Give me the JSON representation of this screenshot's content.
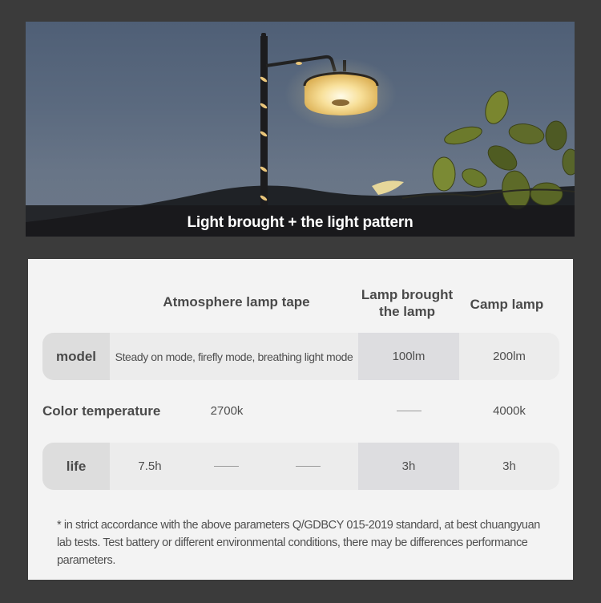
{
  "hero": {
    "caption": "Light brought + the light pattern",
    "image_description": "Dusk sky with a lamp post wrapped in an LED light strip, a glowing round camp lamp hanging from its arm, and green leaves in the foreground"
  },
  "spec_table": {
    "columns": [
      {
        "key": "label",
        "header": ""
      },
      {
        "key": "atmosphere",
        "header": "Atmosphere lamp tape"
      },
      {
        "key": "lamp_brought",
        "header": "Lamp brought the lamp"
      },
      {
        "key": "camp",
        "header": "Camp lamp"
      }
    ],
    "header_lines": {
      "atmosphere": "Atmosphere lamp tape",
      "lamp_brought_line1": "Lamp brought",
      "lamp_brought_line2": "the lamp",
      "camp": "Camp lamp"
    },
    "rows": [
      {
        "label": "model",
        "atmosphere": "Steady on mode, firefly mode, breathing light mode",
        "lamp_brought": "100lm",
        "camp": "200lm"
      },
      {
        "label": "Color temperature",
        "atmosphere": "2700k",
        "lamp_brought": "—",
        "camp": "4000k"
      },
      {
        "label": "life",
        "atmosphere": "7.5h",
        "atmosphere_extra": [
          "—",
          "—"
        ],
        "lamp_brought": "3h",
        "camp": "3h"
      }
    ]
  },
  "footnote": "* in strict accordance with the above parameters Q/GDBCY 015-2019 standard, at best chuangyuan lab tests. Test battery or different environmental conditions, there may be differences performance parameters.",
  "colors": {
    "page_background": "#3b3b3b",
    "card_background": "#f3f3f3",
    "pill_background": "#ececec",
    "label_cell_background": "#dddddd",
    "lamp_column_background": "#dddde0",
    "text": "#4a4a4a",
    "caption_text": "#ffffff",
    "lamp_glow": "#f6d27a"
  }
}
